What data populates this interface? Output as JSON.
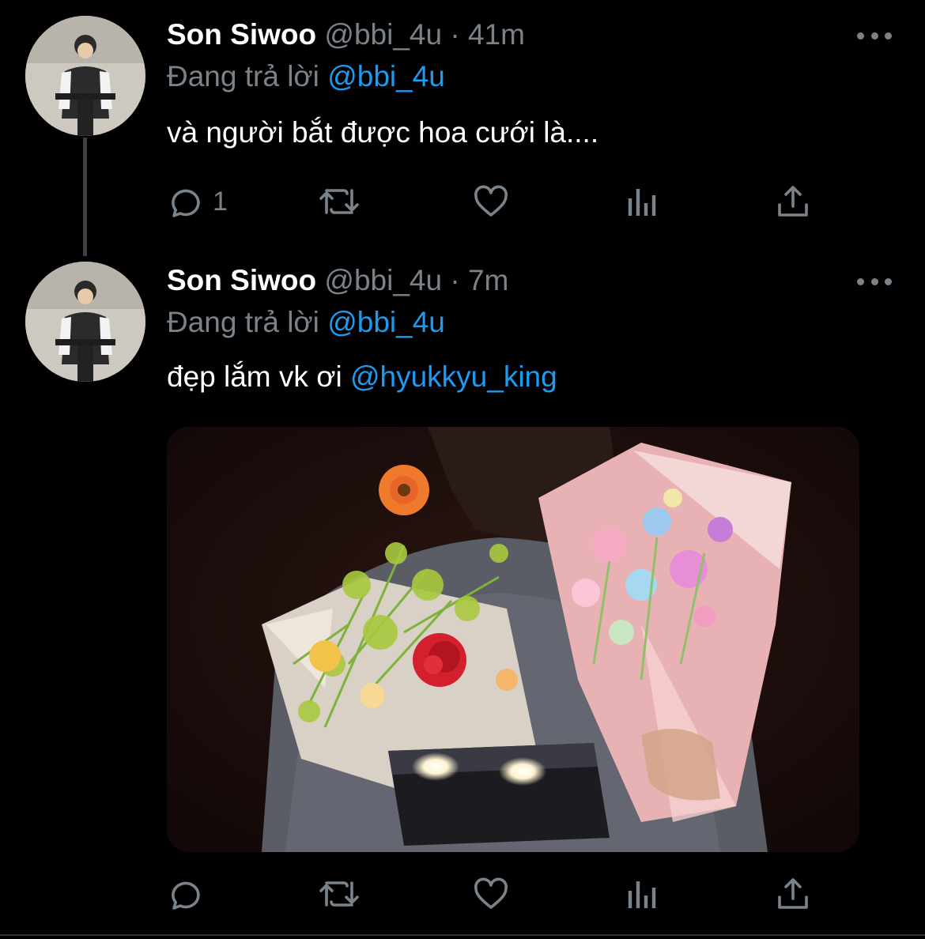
{
  "tweets": [
    {
      "author_name": "Son Siwoo",
      "author_handle": "@bbi_4u",
      "separator": "·",
      "time": "41m",
      "reply_prefix": "Đang trả lời",
      "reply_to": "@bbi_4u",
      "text": "và người bắt được hoa cưới là....",
      "text_mention": "",
      "reply_count": "1",
      "icons": [
        "reply-icon",
        "retweet-icon",
        "like-icon",
        "analytics-icon",
        "share-icon",
        "more-icon"
      ]
    },
    {
      "author_name": "Son Siwoo",
      "author_handle": "@bbi_4u",
      "separator": "·",
      "time": "7m",
      "reply_prefix": "Đang trả lời",
      "reply_to": "@bbi_4u",
      "text": "đẹp lắm vk ơi",
      "text_mention": "@hyukkyu_king",
      "reply_count": "",
      "icons": [
        "reply-icon",
        "retweet-icon",
        "like-icon",
        "analytics-icon",
        "share-icon",
        "more-icon"
      ],
      "media": "photo"
    }
  ],
  "colors": {
    "background": "#000000",
    "primary_text": "#ffffff",
    "secondary_text": "#7a828a",
    "link": "#1d9bf0"
  }
}
